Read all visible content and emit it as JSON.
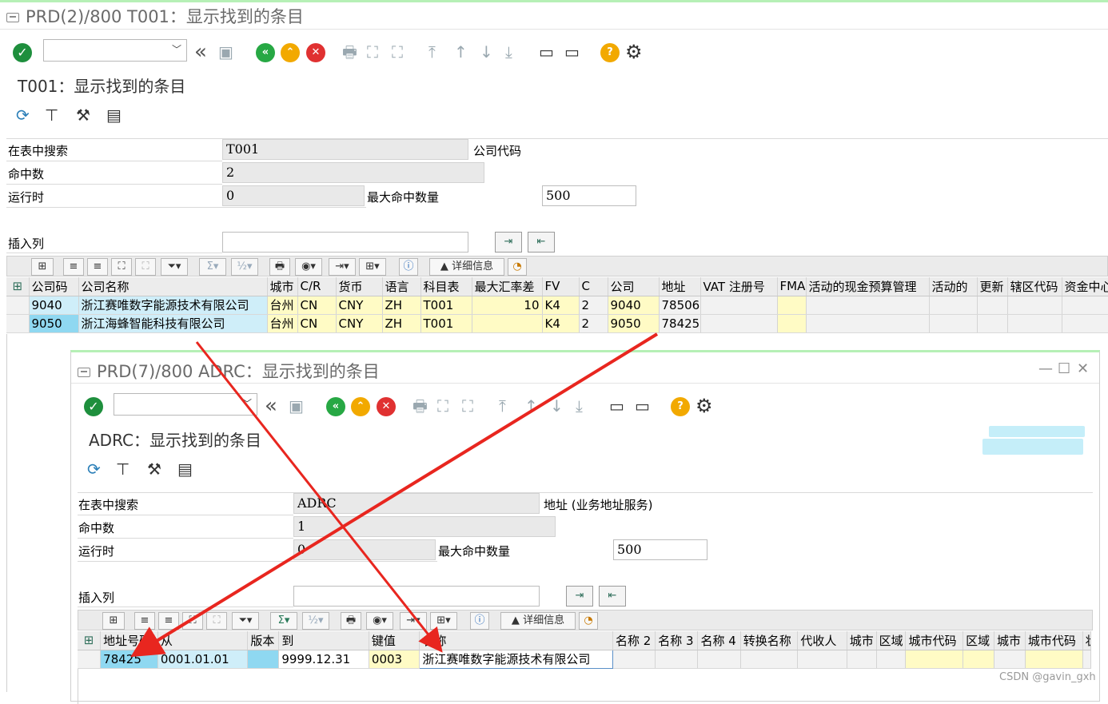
{
  "main": {
    "window_title": "PRD(2)/800 T001：显示找到的条目",
    "page_title": "T001：显示找到的条目",
    "search": {
      "label": "在表中搜索",
      "value": "T001",
      "desc": "公司代码",
      "hits_label": "命中数",
      "hits": "2",
      "runtime_label": "运行时",
      "runtime": "0",
      "max_hits_label": "最大命中数量",
      "max_hits": "500",
      "insert_col_label": "插入列",
      "insert_col_value": ""
    },
    "alv_details_label": "详细信息",
    "columns": [
      "公司码",
      "公司名称",
      "城市",
      "C/R",
      "货币",
      "语言",
      "科目表",
      "最大汇率差",
      "FV",
      "C",
      "公司",
      "地址",
      "VAT 注册号",
      "FMA",
      "活动的现金预算管理",
      "活动的",
      "更新",
      "辖区代码",
      "资金中心"
    ],
    "rows": [
      [
        "9040",
        "浙江赛唯数字能源技术有限公司",
        "台州",
        "CN",
        "CNY",
        "ZH",
        "T001",
        "10",
        "K4",
        "2",
        "9040",
        "78506",
        "",
        "",
        "",
        "",
        "",
        "",
        ""
      ],
      [
        "9050",
        "浙江海蜂智能科技有限公司",
        "台州",
        "CN",
        "CNY",
        "ZH",
        "T001",
        "",
        "K4",
        "2",
        "9050",
        "78425",
        "",
        "",
        "",
        "",
        "",
        "",
        ""
      ]
    ]
  },
  "popup": {
    "window_title": "PRD(7)/800 ADRC：显示找到的条目",
    "page_title": "ADRC：显示找到的条目",
    "search": {
      "label": "在表中搜索",
      "value": "ADRC",
      "desc": "地址 (业务地址服务)",
      "hits_label": "命中数",
      "hits": "1",
      "runtime_label": "运行时",
      "runtime": "0",
      "max_hits_label": "最大命中数量",
      "max_hits": "500",
      "insert_col_label": "插入列",
      "insert_col_value": ""
    },
    "alv_details_label": "详细信息",
    "columns": [
      "地址号码",
      "从",
      "版本",
      "到",
      "键值",
      "名称",
      "名称 2",
      "名称 3",
      "名称 4",
      "转换名称",
      "代收人",
      "城市",
      "区域",
      "城市代码",
      "区域",
      "城市",
      "城市代码",
      "状态"
    ],
    "rows": [
      [
        "78425",
        "0001.01.01",
        "",
        "9999.12.31",
        "0003",
        "浙江赛唯数字能源技术有限公司",
        "",
        "",
        "",
        "",
        "",
        "",
        "",
        "",
        "",
        "",
        "",
        ""
      ]
    ]
  },
  "watermark": "CSDN @gavin_gxh",
  "colors": {
    "ok_green": "#1e8f3d",
    "back_green": "#27a844",
    "up_orange": "#f2a900",
    "cancel_red": "#e03131",
    "key_cell_blue": "#cfeef9",
    "key_cell_selected": "#8fd8f1",
    "input_cell_yellow": "#fffbc5",
    "arrow_red": "#e8261f"
  }
}
